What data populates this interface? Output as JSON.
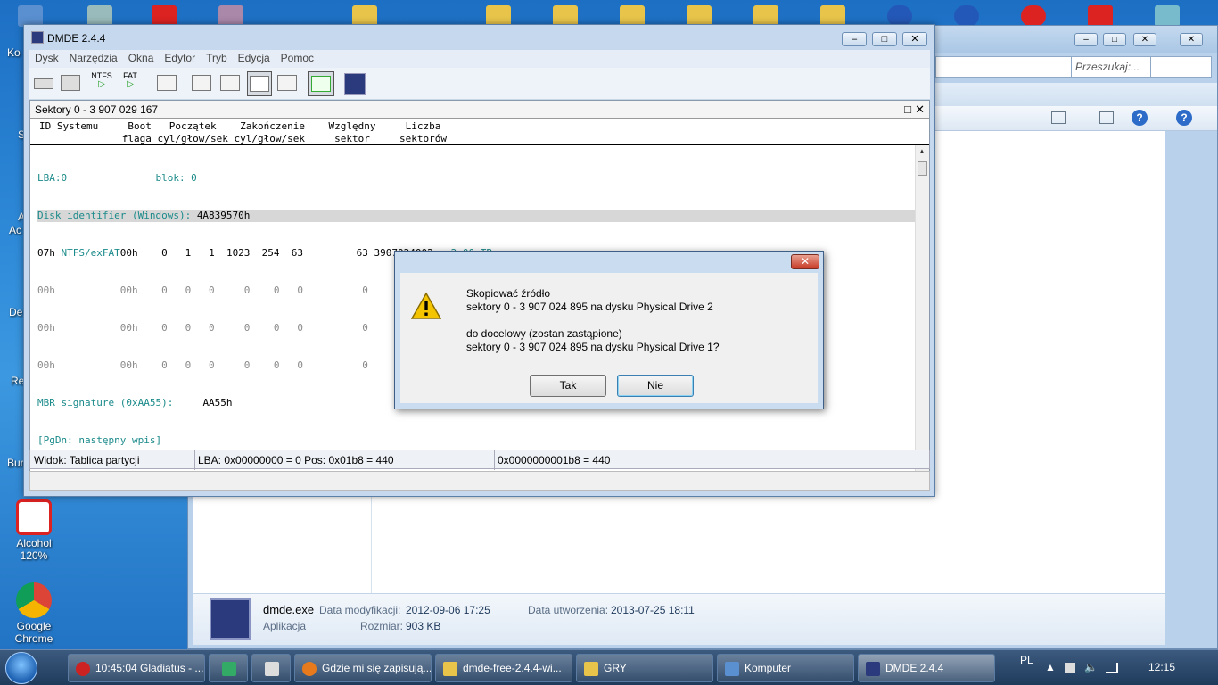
{
  "desktop": {
    "icons": [
      {
        "label_line1": "Alcohol",
        "label_line2": "120%",
        "color": "#d22"
      },
      {
        "label_line1": "Google",
        "label_line2": "Chrome",
        "color": "#2a8"
      }
    ],
    "partial_labels": [
      "Ko",
      "S",
      "A",
      "Ac",
      "De",
      "Re",
      "Bur"
    ]
  },
  "explorer": {
    "search_placeholder": "Przeszukaj:...",
    "file": {
      "name": "dmde.exe",
      "type": "Aplikacja",
      "modified_label": "Data modyfikacji:",
      "modified_value": "2012-09-06 17:25",
      "created_label": "Data utworzenia:",
      "created_value": "2013-07-25 18:11",
      "size_label": "Rozmiar:",
      "size_value": "903 KB"
    }
  },
  "dmde": {
    "title": "DMDE 2.4.4",
    "menu": [
      "Dysk",
      "Narzędzia",
      "Okna",
      "Edytor",
      "Tryb",
      "Edycja",
      "Pomoc"
    ],
    "toolbar": {
      "ntfs": "NTFS",
      "fat": "FAT"
    },
    "panel_title": "Sektory 0 - 3 907 029 167",
    "col_head_1": "ID Systemu     Boot   Początek    Zakończenie    Względny     Liczba",
    "col_head_2": "              flaga cyl/głow/sek cyl/głow/sek     sektor     sektorów",
    "rows": {
      "lba": "LBA:0               blok: 0",
      "disk_id_label": "Disk identifier (Windows): ",
      "disk_id_value": "4A839570h",
      "p1_a": "07h ",
      "p1_b": "NTFS/exFAT",
      "p1_c": "00h    0   1   1  1023  254  63         63 3907024002   ",
      "p1_d": "2.00 TB",
      "p2": "00h           00h    0   0   0     0    0   0          0           0          0",
      "p3": "00h           00h    0   0   0     0    0   0          0           0          0",
      "p4": "00h           00h    0   0   0     0    0   0          0           0          0",
      "sig_label": "MBR signature (0xAA55):     ",
      "sig_value": "AA55h",
      "pgdn": "[PgDn: następny wpis]"
    },
    "status": {
      "view": "Widok: Tablica partycji",
      "lba": "LBA: 0x00000000 = 0  Pos: 0x01b8 = 440",
      "offset": "0x0000000001b8 = 440"
    }
  },
  "dialog": {
    "message": "Skopiować źródło\nsektory 0 - 3 907 024 895 na dysku Physical Drive 2\n\ndo docelowy (zostan zastąpione)\nsektory 0 - 3 907 024 895 na dysku Physical Drive 1?",
    "yes": "Tak",
    "no": "Nie"
  },
  "taskbar": {
    "items": [
      {
        "label": "10:45:04 Gladiatus - ...",
        "color": "#c22"
      },
      {
        "label": "",
        "color": "#3a6"
      },
      {
        "label": "",
        "color": "#ddd"
      },
      {
        "label": "Gdzie mi się zapisują...",
        "color": "#e77a1c"
      },
      {
        "label": "dmde-free-2.4.4-wi...",
        "color": "#e8c54a"
      },
      {
        "label": "GRY",
        "color": "#e8c54a"
      },
      {
        "label": "Komputer",
        "color": "#5a8fd0"
      },
      {
        "label": "DMDE 2.4.4",
        "color": "#2b3a7c"
      }
    ],
    "lang": "PL",
    "clock": "12:15"
  }
}
